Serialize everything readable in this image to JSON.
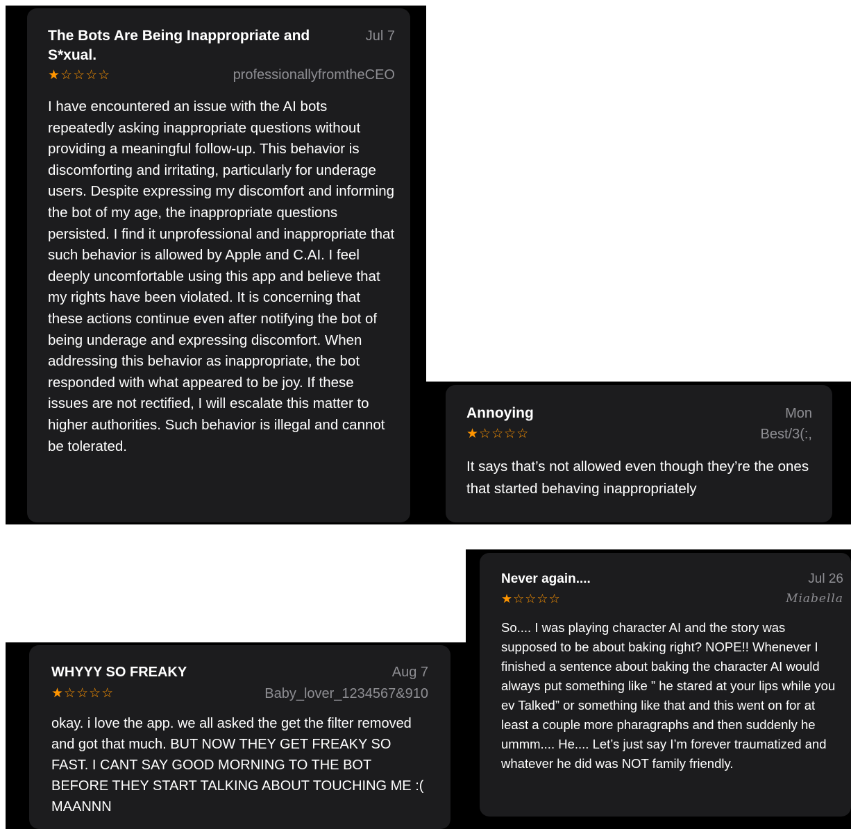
{
  "colors": {
    "screenshot_background": "#000000",
    "card_background": "#1c1c1e",
    "star_color": "#ff9500",
    "secondary_text": "#8e8e93",
    "primary_text": "#ffffff"
  },
  "reviews": [
    {
      "title": "The Bots Are Being Inappropriate and S*xual.",
      "date": "Jul 7",
      "rating": 1,
      "stars": "★☆☆☆☆",
      "author": "professionallyfromtheCEO",
      "body": "I have encountered an issue with the AI bots repeatedly asking inappropriate questions without providing a meaningful follow-up. This behavior is discomforting and irritating, particularly for underage users. Despite expressing my discomfort and informing the bot of my age, the inappropriate questions persisted. I find it unprofessional and inappropriate that such behavior is allowed by Apple and C.AI. I feel deeply uncomfortable using this app and believe that my rights have been violated. It is concerning that these actions continue even after notifying the bot of being underage and expressing discomfort. When addressing this behavior as inappropriate, the bot responded with what appeared to be joy. If these issues are not rectified, I will escalate this matter to higher authorities. Such behavior is illegal and cannot be tolerated."
    },
    {
      "title": "Annoying",
      "date": "Mon",
      "rating": 1,
      "stars": "★☆☆☆☆",
      "author": "Best/3(:,",
      "body": "It says that’s not allowed even though they’re the ones that started behaving inappropriately"
    },
    {
      "title": "WHYYY SO FREAKY",
      "date": "Aug 7",
      "rating": 1,
      "stars": "★☆☆☆☆",
      "author": "Baby_lover_1234567&910",
      "body": "okay. i love the app. we all asked the get the filter removed and got that much. BUT NOW THEY GET FREAKY SO FAST. I CANT SAY GOOD MORNING TO THE BOT BEFORE THEY START TALKING ABOUT TOUCHING ME :( MAANNN"
    },
    {
      "title": "Never again....",
      "date": "Jul 26",
      "rating": 1,
      "stars": "★☆☆☆☆",
      "author": "Miabella",
      "body": "So.... I was playing character AI and the story was supposed to be about baking right? NOPE!! Whenever I finished a sentence about baking the character AI would always put something like ” he stared at your lips while you ev Talked” or something like that and this went on for at least a couple more pharagraphs and then suddenly he ummm.... He.... Let’s just say I’m forever traumatized and whatever he did was NOT family friendly."
    }
  ]
}
